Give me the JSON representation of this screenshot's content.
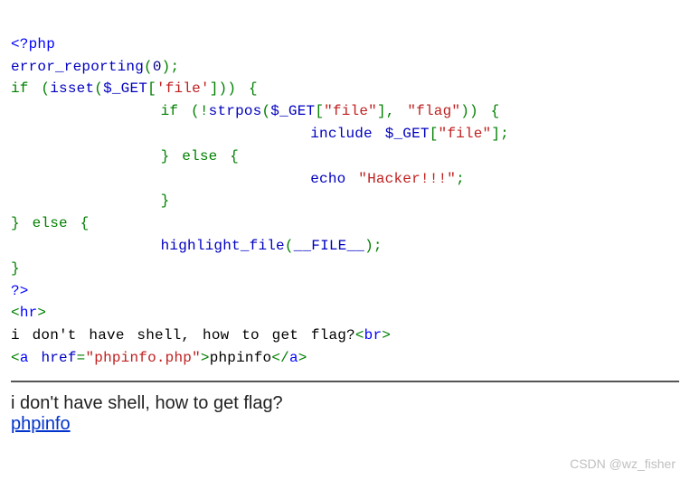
{
  "code": {
    "l1": {
      "open": "<?php"
    },
    "l2": {
      "fn": "error_reporting",
      "op": "(",
      "num": "0",
      "cp": ")",
      "semi": ";"
    },
    "l3": {
      "kw": "if",
      "sp": " ",
      "op1": "(",
      "fn": "isset",
      "op2": "(",
      "var": "$_GET",
      "br1": "[",
      "q1": "'",
      "key": "file",
      "q2": "'",
      "br2": "]",
      "cp2": ")",
      "cp1": ")",
      "sp2": " ",
      "brace": "{"
    },
    "l4": {
      "indent": "            ",
      "kw": "if",
      "sp": " ",
      "op1": "(",
      "neg": "!",
      "fn": "strpos",
      "op2": "(",
      "var": "$_GET",
      "br1": "[",
      "str1": "\"file\"",
      "br2": "]",
      "comma": ",",
      "sp2": " ",
      "str2": "\"flag\"",
      "cp2": ")",
      "cp1": ")",
      "sp3": " ",
      "brace": "{"
    },
    "l5": {
      "indent": "                        ",
      "fn": "include",
      "sp": " ",
      "var": "$_GET",
      "br1": "[",
      "str": "\"file\"",
      "br2": "]",
      "semi": ";"
    },
    "l6": {
      "indent": "            ",
      "brace": "}",
      "sp": " ",
      "kw": "else",
      "sp2": " ",
      "brace2": "{"
    },
    "l7": {
      "indent": "                        ",
      "fn": "echo",
      "sp": " ",
      "str": "\"Hacker!!!\"",
      "semi": ";"
    },
    "l8": {
      "indent": "            ",
      "brace": "}"
    },
    "l9": {
      "brace": "}",
      "sp": " ",
      "kw": "else",
      "sp2": " ",
      "brace2": "{"
    },
    "l10": {
      "indent": "            ",
      "fn": "highlight_file",
      "op": "(",
      "const": "__FILE__",
      "cp": ")",
      "semi": ";"
    },
    "l11": {
      "brace": "}"
    },
    "l12": {
      "close": "?>"
    },
    "l13": {
      "tag_open": "<",
      "tag_name": "hr",
      "tag_close": ">"
    },
    "l14": {
      "text1": "i don't have shell, how to get flag?",
      "tag_open": "<",
      "tag_name": "br",
      "tag_close": ">"
    },
    "l15": {
      "a_open": "<",
      "a_name": "a",
      "sp": " ",
      "attr": "href",
      "eq": "=",
      "href": "\"phpinfo.php\"",
      "a_close": ">",
      "link_text": "phpinfo",
      "ac_open": "</",
      "ac_name": "a",
      "ac_close": ">"
    }
  },
  "rendered": {
    "text": "i don't have shell, how to get flag?",
    "link": "phpinfo"
  },
  "watermark": "CSDN @wz_fisher"
}
